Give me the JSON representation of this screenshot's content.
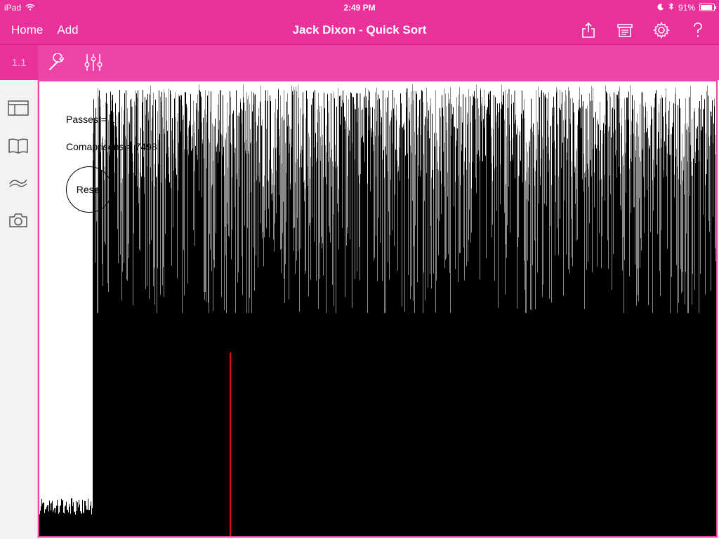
{
  "status_bar": {
    "carrier": "iPad",
    "time": "2:49 PM",
    "battery": "91%",
    "battery_level": 0.91
  },
  "nav": {
    "home_label": "Home",
    "add_label": "Add",
    "title": "Jack Dixon - Quick Sort",
    "icons": [
      "share-icon",
      "document-icon",
      "settings-gear-icon",
      "help-icon"
    ]
  },
  "toolbar": {
    "page_label": "1.1",
    "icons": [
      "wrench-icon",
      "sliders-icon"
    ]
  },
  "sidebar": {
    "icons": [
      "document-layout-icon",
      "book-icon",
      "gesture-icon",
      "camera-icon"
    ]
  },
  "canvas": {
    "passes_text": "Passes = 1",
    "comparisons_text": "Comaprisons = 7498",
    "reset_label": "Reset",
    "colors": {
      "frame": "#ee44aa",
      "bars": "#000000",
      "bar_highlight": "#888888",
      "marker": "#dd1111"
    }
  }
}
